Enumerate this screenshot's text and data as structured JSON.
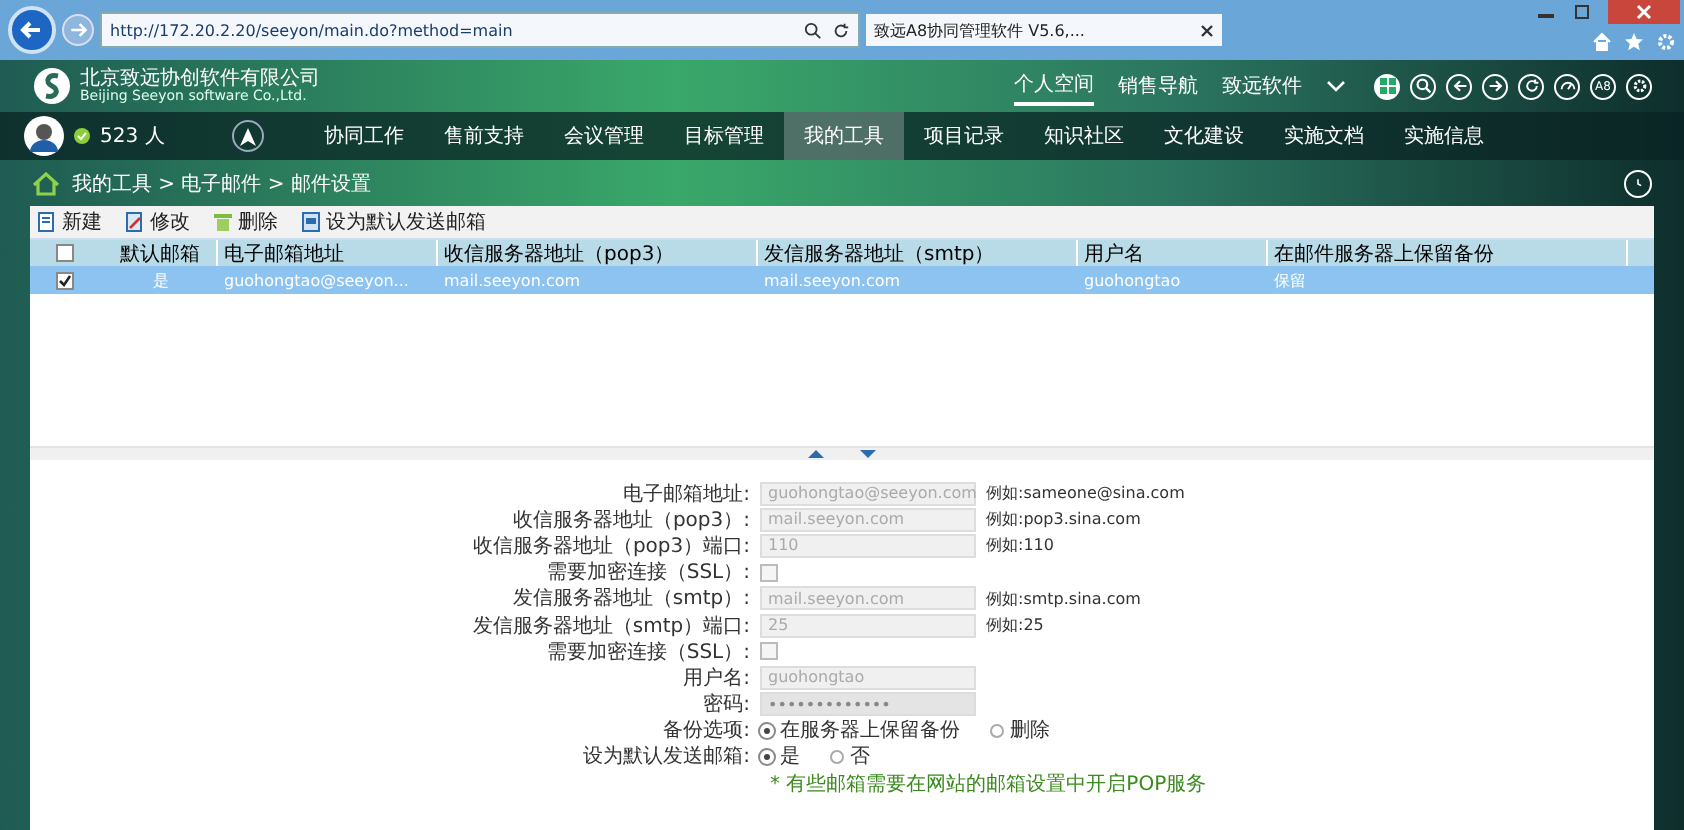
{
  "browser": {
    "address": "http://172.20.2.20/seeyon/main.do?method=main",
    "tab_title": "致远A8协同管理软件 V5.6,..."
  },
  "header": {
    "logo_cn": "北京致远协创软件有限公司",
    "logo_en": "Beijing Seeyon software Co.,Ltd.",
    "top_links": [
      {
        "label": "个人空间",
        "selected": true
      },
      {
        "label": "销售导航",
        "selected": false
      },
      {
        "label": "致远软件",
        "selected": false
      }
    ],
    "online": "523 人",
    "badge_text": "A8"
  },
  "nav": [
    {
      "label": "协同工作",
      "selected": false
    },
    {
      "label": "售前支持",
      "selected": false
    },
    {
      "label": "会议管理",
      "selected": false
    },
    {
      "label": "目标管理",
      "selected": false
    },
    {
      "label": "我的工具",
      "selected": true
    },
    {
      "label": "项目记录",
      "selected": false
    },
    {
      "label": "知识社区",
      "selected": false
    },
    {
      "label": "文化建设",
      "selected": false
    },
    {
      "label": "实施文档",
      "selected": false
    },
    {
      "label": "实施信息",
      "selected": false
    }
  ],
  "breadcrumb": "我的工具 > 电子邮件 > 邮件设置",
  "toolbar": [
    {
      "label": "新建",
      "kind": "new"
    },
    {
      "label": "修改",
      "kind": "edit"
    },
    {
      "label": "删除",
      "kind": "delete"
    },
    {
      "label": "设为默认发送邮箱",
      "kind": "default"
    }
  ],
  "table": {
    "select_all_checked": false,
    "columns": [
      "默认邮箱",
      "电子邮箱地址",
      "收信服务器地址（pop3）",
      "发信服务器地址（smtp）",
      "用户名",
      "在邮件服务器上保留备份"
    ],
    "rows": [
      {
        "checked": true,
        "selected": true,
        "cells": [
          "是",
          "guohongtao@seeyon...",
          "mail.seeyon.com",
          "mail.seeyon.com",
          "guohongtao",
          "保留"
        ]
      }
    ]
  },
  "form": {
    "fields": [
      {
        "kind": "text",
        "label": "电子邮箱地址:",
        "value": "guohongtao@seeyon.com",
        "example": "例如:sameone@sina.com"
      },
      {
        "kind": "text",
        "label": "收信服务器地址（pop3）:",
        "value": "mail.seeyon.com",
        "example": "例如:pop3.sina.com"
      },
      {
        "kind": "text",
        "label": "收信服务器地址（pop3）端口:",
        "value": "110",
        "example": "例如:110"
      },
      {
        "kind": "checkbox",
        "label": "需要加密连接（SSL）:",
        "checked": false
      },
      {
        "kind": "text",
        "label": "发信服务器地址（smtp）:",
        "value": "mail.seeyon.com",
        "example": "例如:smtp.sina.com"
      },
      {
        "kind": "text",
        "label": "发信服务器地址（smtp）端口:",
        "value": "25",
        "example": "例如:25"
      },
      {
        "kind": "checkbox",
        "label": "需要加密连接（SSL）:",
        "checked": false
      },
      {
        "kind": "text",
        "label": "用户名:",
        "value": "guohongtao"
      },
      {
        "kind": "password",
        "label": "密码:",
        "value": "•••••••••••••"
      },
      {
        "kind": "radio",
        "label": "备份选项:",
        "options": [
          {
            "label": "在服务器上保留备份",
            "selected": true
          },
          {
            "label": "删除",
            "selected": false
          }
        ]
      },
      {
        "kind": "radio",
        "label": "设为默认发送邮箱:",
        "options": [
          {
            "label": "是",
            "selected": true
          },
          {
            "label": "否",
            "selected": false
          }
        ]
      }
    ],
    "note": "* 有些邮箱需要在网站的邮箱设置中开启POP服务"
  }
}
